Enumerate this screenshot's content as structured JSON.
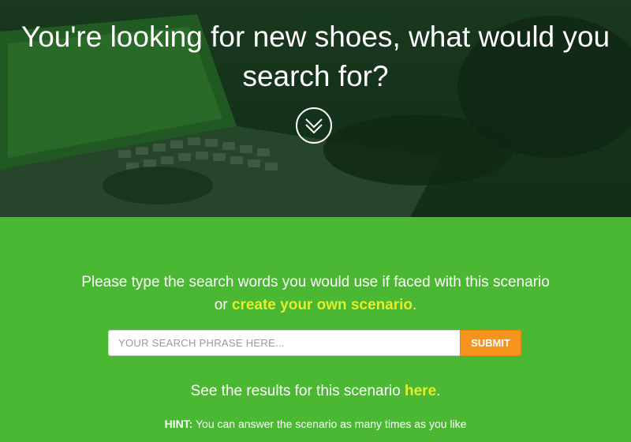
{
  "hero": {
    "title": "You're looking for new shoes, what would you search for?",
    "scroll_icon": "chevron-double-down-icon"
  },
  "prompt": {
    "text_before": "Please type the search words you would use if faced with this scenario or ",
    "link": "create your own scenario",
    "text_after": "."
  },
  "search": {
    "placeholder": "YOUR SEARCH PHRASE HERE...",
    "value": "",
    "submit_label": "SUBMIT"
  },
  "results": {
    "text": "See the results for this scenario ",
    "link": "here",
    "after": "."
  },
  "hint": {
    "label": "HINT:",
    "text": " You can answer the scenario as many times as you like"
  },
  "colors": {
    "panel_green": "#4ab833",
    "link_yellow": "#e2ee2c",
    "submit_orange": "#f7941d",
    "hero_dark": "#15301a"
  }
}
